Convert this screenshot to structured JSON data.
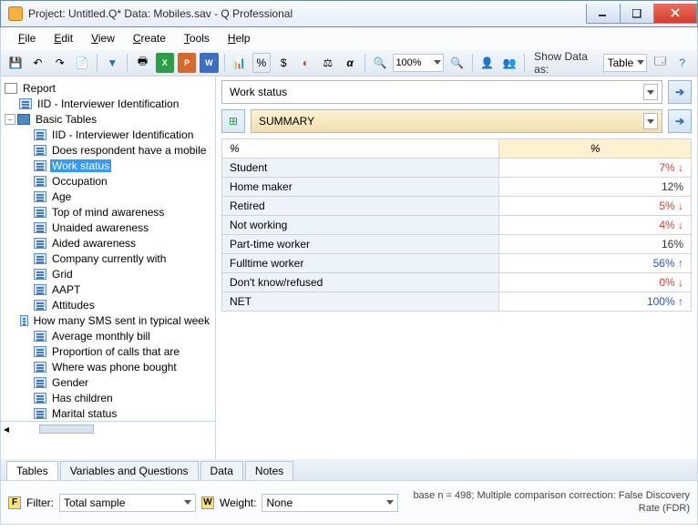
{
  "window": {
    "title": "Project: Untitled.Q*  Data: Mobiles.sav - Q Professional"
  },
  "menu": {
    "file": "File",
    "edit": "Edit",
    "view": "View",
    "create": "Create",
    "tools": "Tools",
    "help": "Help"
  },
  "toolbar": {
    "zoom": "100%",
    "show_data_label": "Show Data as:",
    "show_data_value": "Table"
  },
  "tree": {
    "root": "Report",
    "item_iid_root": "IID - Interviewer Identification",
    "folder": "Basic Tables",
    "items": [
      "IID - Interviewer Identification",
      "Does respondent have a mobile",
      "Work status",
      "Occupation",
      "Age",
      "Top of mind awareness",
      "Unaided awareness",
      "Aided awareness",
      "Company currently with",
      "Grid",
      "AAPT",
      "Attitudes",
      "How many SMS sent in typical week",
      "Average monthly bill",
      "Proportion of calls that are",
      "Where was phone bought",
      "Gender",
      "Has children",
      "Marital status"
    ],
    "selected_index": 2
  },
  "variable": {
    "label": "Work status",
    "summary": "SUMMARY"
  },
  "chart_data": {
    "type": "table",
    "col_header": "%",
    "corner": "%",
    "rows": [
      {
        "label": "Student",
        "value": "7%",
        "dir": "down",
        "color": "red"
      },
      {
        "label": "Home maker",
        "value": "12%",
        "dir": "",
        "color": ""
      },
      {
        "label": "Retired",
        "value": "5%",
        "dir": "down",
        "color": "red"
      },
      {
        "label": "Not working",
        "value": "4%",
        "dir": "down",
        "color": "red"
      },
      {
        "label": "Part-time worker",
        "value": "16%",
        "dir": "",
        "color": ""
      },
      {
        "label": "Fulltime worker",
        "value": "56%",
        "dir": "up",
        "color": "blue"
      },
      {
        "label": "Don't know/refused",
        "value": "0%",
        "dir": "down",
        "color": "red"
      },
      {
        "label": "NET",
        "value": "100%",
        "dir": "up",
        "color": "blue"
      }
    ]
  },
  "tabs": {
    "t1": "Tables",
    "t2": "Variables and Questions",
    "t3": "Data",
    "t4": "Notes"
  },
  "bottom": {
    "filter_label": "Filter:",
    "filter_value": "Total sample",
    "weight_label": "Weight:",
    "weight_value": "None",
    "status": "base n = 498; Multiple comparison correction: False Discovery Rate (FDR)"
  }
}
